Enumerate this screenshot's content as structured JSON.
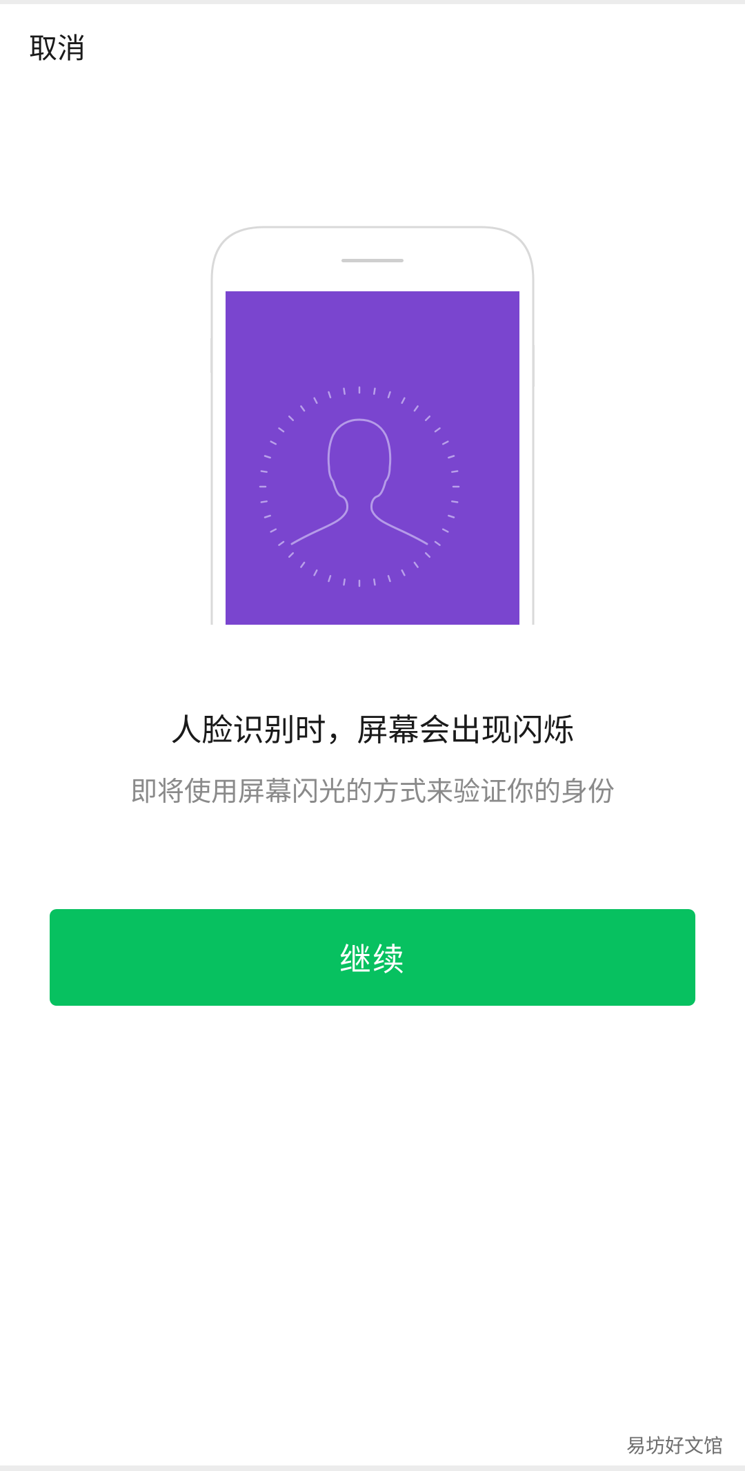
{
  "header": {
    "cancel_label": "取消"
  },
  "illustration": {
    "icon": "phone-face-scan-icon",
    "screen_color": "#7a45cf"
  },
  "content": {
    "headline": "人脸识别时，屏幕会出现闪烁",
    "subtext": "即将使用屏幕闪光的方式来验证你的身份"
  },
  "actions": {
    "continue_label": "继续",
    "continue_color": "#07c160"
  },
  "watermark": "易坊好文馆"
}
